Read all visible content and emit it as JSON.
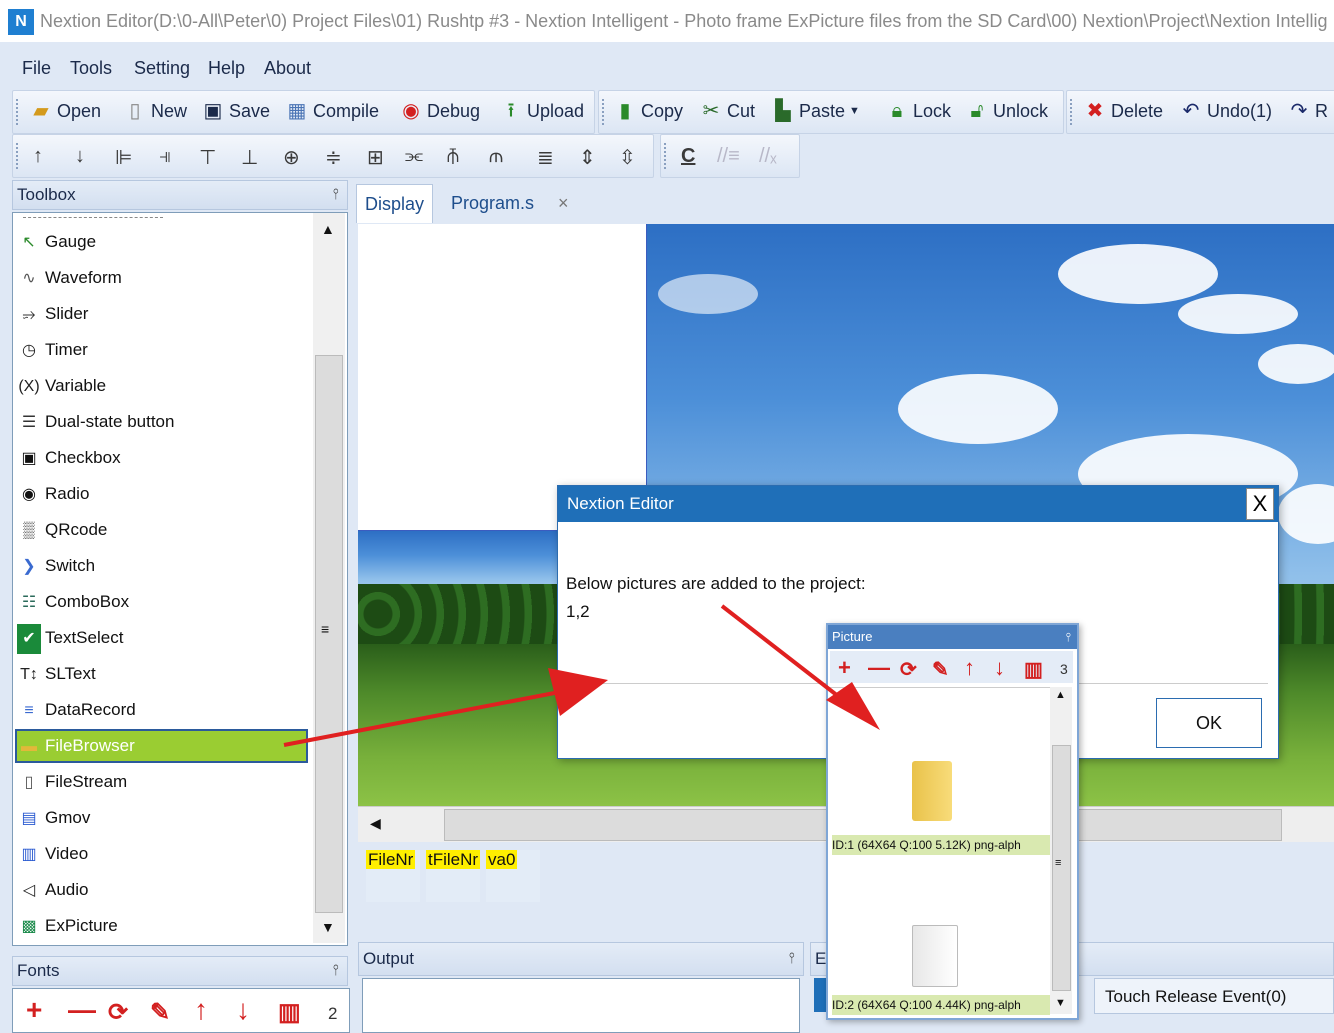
{
  "window": {
    "title": "Nextion Editor(D:\\0-All\\Peter\\0) Project Files\\01) Rushtp #3 - Nextion Intelligent - Photo frame ExPicture files from the SD Card\\00) Nextion\\Project\\Nextion Intellig",
    "app_icon": "nextion-logo-icon"
  },
  "menu": [
    "File",
    "Tools",
    "Setting",
    "Help",
    "About"
  ],
  "toolbar": {
    "open": "Open",
    "new": "New",
    "save": "Save",
    "compile": "Compile",
    "debug": "Debug",
    "upload": "Upload",
    "copy": "Copy",
    "cut": "Cut",
    "paste": "Paste",
    "lock": "Lock",
    "unlock": "Unlock",
    "delete": "Delete",
    "undo": "Undo(1)",
    "redo": "R",
    "comment": "C"
  },
  "toolbox": {
    "title": "Toolbox",
    "pin": "⫯",
    "items": [
      {
        "label": "Gauge",
        "icon": "cursor-arrow-icon",
        "glyph": "↖"
      },
      {
        "label": "Waveform",
        "icon": "waveform-icon",
        "glyph": "∿"
      },
      {
        "label": "Slider",
        "icon": "slider-icon",
        "glyph": "⭌"
      },
      {
        "label": "Timer",
        "icon": "clock-icon",
        "glyph": "◷"
      },
      {
        "label": "Variable",
        "icon": "variable-icon",
        "glyph": "(X)"
      },
      {
        "label": "Dual-state button",
        "icon": "dual-state-icon",
        "glyph": "☰"
      },
      {
        "label": "Checkbox",
        "icon": "checkbox-icon",
        "glyph": "▣"
      },
      {
        "label": "Radio",
        "icon": "radio-icon",
        "glyph": "◉"
      },
      {
        "label": "QRcode",
        "icon": "qrcode-icon",
        "glyph": "▒"
      },
      {
        "label": "Switch",
        "icon": "switch-icon",
        "glyph": "❯"
      },
      {
        "label": "ComboBox",
        "icon": "combobox-icon",
        "glyph": "☷"
      },
      {
        "label": "TextSelect",
        "icon": "textselect-icon",
        "glyph": "✔"
      },
      {
        "label": "SLText",
        "icon": "sltext-icon",
        "glyph": "T↕"
      },
      {
        "label": "DataRecord",
        "icon": "datarecord-icon",
        "glyph": "≡"
      },
      {
        "label": "FileBrowser",
        "icon": "folder-icon",
        "glyph": "▬"
      },
      {
        "label": "FileStream",
        "icon": "file-icon",
        "glyph": "▯"
      },
      {
        "label": "Gmov",
        "icon": "gmov-icon",
        "glyph": "▤"
      },
      {
        "label": "Video",
        "icon": "video-icon",
        "glyph": "▥"
      },
      {
        "label": "Audio",
        "icon": "audio-icon",
        "glyph": "◁"
      },
      {
        "label": "ExPicture",
        "icon": "expicture-icon",
        "glyph": "▩"
      }
    ],
    "selected": "FileBrowser"
  },
  "fonts_panel": {
    "title": "Fonts",
    "count": "2"
  },
  "tabs": [
    {
      "label": "Display"
    },
    {
      "label": "Program.s"
    }
  ],
  "tab_close": "×",
  "components": [
    "FileNr",
    "tFileNr",
    "va0"
  ],
  "output_panel": {
    "title": "Output"
  },
  "event_panel": {
    "title_fragment": "E",
    "tab": "Touch Release Event(0)"
  },
  "dialog": {
    "title": "Nextion Editor",
    "close": "X",
    "message": "Below pictures are added to the project:",
    "ids": "1,2",
    "ok": "OK"
  },
  "picture_window": {
    "title": "Picture",
    "count": "3",
    "items": [
      {
        "caption": "ID:1  (64X64 Q:100 5.12K) png-alph",
        "icon": "folder-icon"
      },
      {
        "caption": "ID:2  (64X64 Q:100 4.44K) png-alph",
        "icon": "file-icon"
      }
    ]
  },
  "colors": {
    "accent": "#1f6fb8",
    "selection": "#9acd32",
    "annotation_arrow": "#e02020"
  }
}
